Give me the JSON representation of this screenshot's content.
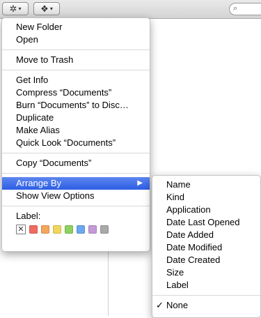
{
  "toolbar": {
    "action_glyph": "✲",
    "dropbox_glyph": "❖",
    "caret": "▾",
    "search_glyph": "⌕"
  },
  "context_menu": {
    "group1": [
      "New Folder",
      "Open"
    ],
    "group2": [
      "Move to Trash"
    ],
    "group3": [
      "Get Info",
      "Compress “Documents”",
      "Burn “Documents” to Disc…",
      "Duplicate",
      "Make Alias",
      "Quick Look “Documents”"
    ],
    "group4": [
      "Copy “Documents”"
    ],
    "group5": [
      "Arrange By",
      "Show View Options"
    ],
    "submenu_arrow": "▶",
    "label_heading": "Label:",
    "label_none_glyph": "✕",
    "label_colors": [
      "#f06a5f",
      "#f5a65b",
      "#f2d65c",
      "#8ed160",
      "#6aa8ef",
      "#c49ad8",
      "#a9a9a9"
    ]
  },
  "arrange_submenu": {
    "items": [
      "Name",
      "Kind",
      "Application",
      "Date Last Opened",
      "Date Added",
      "Date Modified",
      "Date Created",
      "Size",
      "Label"
    ],
    "selected": "None",
    "checkmark": "✓"
  },
  "colors": {
    "highlight": "#3366e6"
  }
}
